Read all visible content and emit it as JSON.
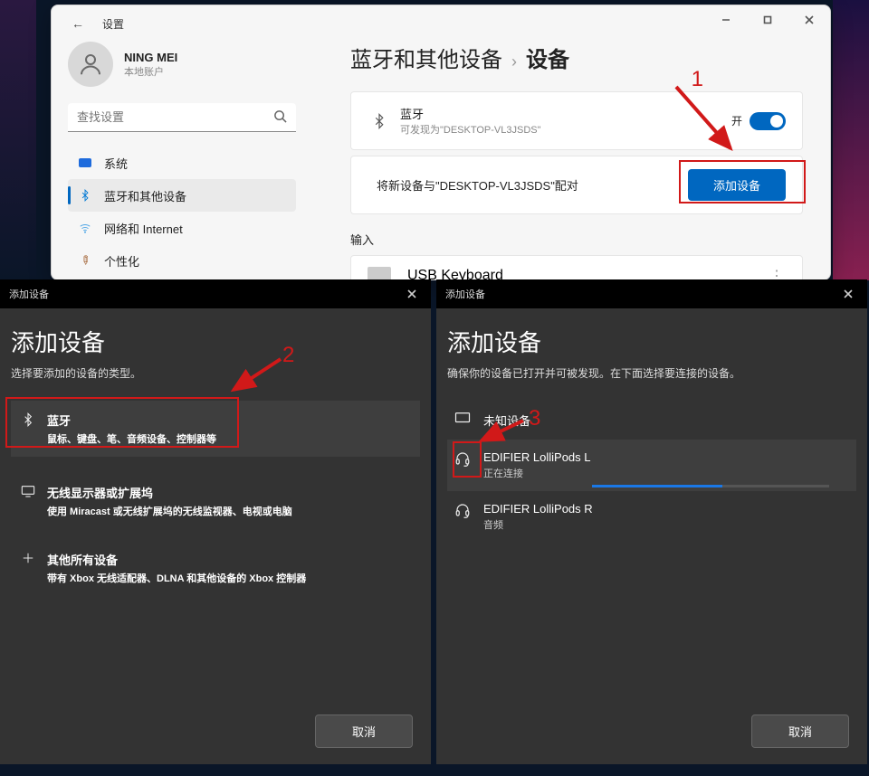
{
  "window": {
    "title": "设置",
    "user": {
      "name": "NING MEI",
      "sub": "本地账户"
    },
    "search_placeholder": "查找设置",
    "nav": {
      "system": "系统",
      "bluetooth": "蓝牙和其他设备",
      "network": "网络和 Internet",
      "personalize": "个性化"
    },
    "breadcrumb": {
      "a": "蓝牙和其他设备",
      "b": "设备"
    },
    "bt_card": {
      "title": "蓝牙",
      "sub": "可发现为\"DESKTOP-VL3JSDS\"",
      "state": "开"
    },
    "pair_card": {
      "text": "将新设备与\"DESKTOP-VL3JSDS\"配对",
      "button": "添加设备"
    },
    "input_section": "输入",
    "usb_kb": "USB Keyboard",
    "anno1": "1"
  },
  "dlg_left": {
    "titlebar": "添加设备",
    "heading": "添加设备",
    "sub": "选择要添加的设备的类型。",
    "options": {
      "bt": {
        "t": "蓝牙",
        "d": "鼠标、键盘、笔、音频设备、控制器等"
      },
      "wd": {
        "t": "无线显示器或扩展坞",
        "d": "使用 Miracast 或无线扩展坞的无线监视器、电视或电脑"
      },
      "other": {
        "t": "其他所有设备",
        "d": "带有 Xbox 无线适配器、DLNA 和其他设备的 Xbox 控制器"
      }
    },
    "cancel": "取消",
    "anno2": "2"
  },
  "dlg_right": {
    "titlebar": "添加设备",
    "heading": "添加设备",
    "sub": "确保你的设备已打开并可被发现。在下面选择要连接的设备。",
    "dev_unknown": "未知设备",
    "dev_l": {
      "t": "EDIFIER LolliPods L",
      "s": "正在连接"
    },
    "dev_r": {
      "t": "EDIFIER LolliPods R",
      "s": "音频"
    },
    "cancel": "取消",
    "anno3": "3"
  }
}
